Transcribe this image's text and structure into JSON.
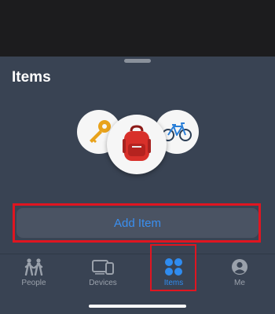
{
  "sheet": {
    "title": "Items"
  },
  "illustration": {
    "pins": [
      {
        "icon": "key-icon"
      },
      {
        "icon": "backpack-icon"
      },
      {
        "icon": "bicycle-icon"
      }
    ]
  },
  "add_item": {
    "label": "Add Item"
  },
  "tabbar": {
    "tabs": [
      {
        "label": "People",
        "icon": "people-icon",
        "selected": false
      },
      {
        "label": "Devices",
        "icon": "devices-icon",
        "selected": false
      },
      {
        "label": "Items",
        "icon": "items-grid-icon",
        "selected": true
      },
      {
        "label": "Me",
        "icon": "person-circle-icon",
        "selected": false
      }
    ]
  },
  "colors": {
    "accent": "#2f8cf0",
    "sheet_background": "#394353",
    "highlight_box": "#e01520"
  }
}
